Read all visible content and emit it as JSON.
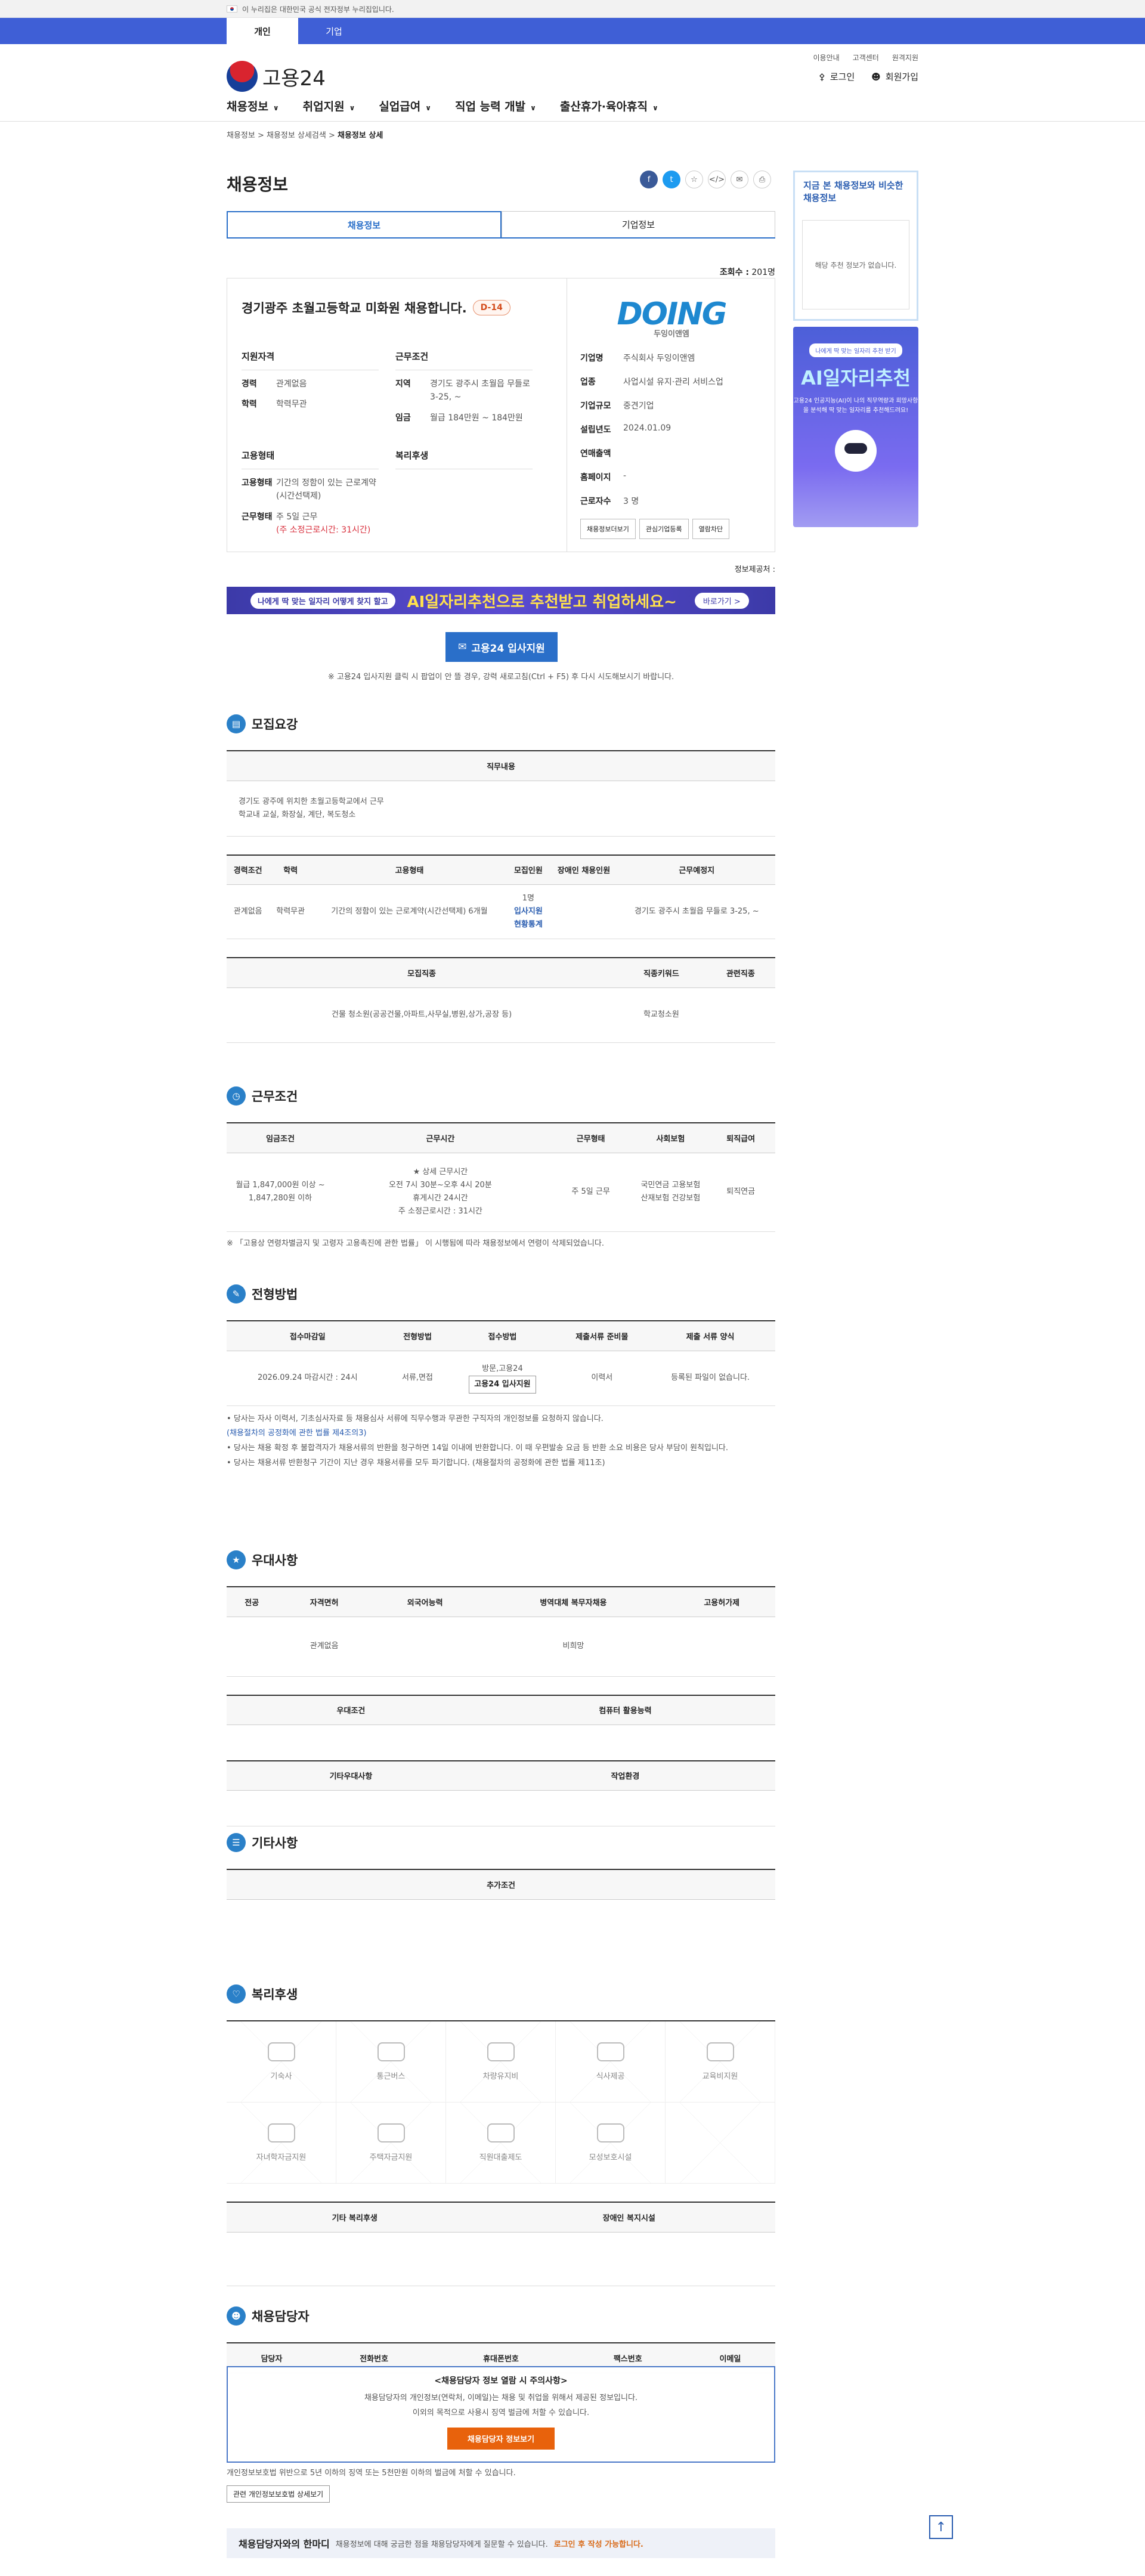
{
  "gov": {
    "text": "이 누리집은 대한민국 공식 전자정부 누리집입니다."
  },
  "user_tabs": [
    "개인",
    "기업"
  ],
  "brand": {
    "name": "고용24"
  },
  "util_links": [
    "이용안내",
    "고객센터",
    "원격지원"
  ],
  "account": {
    "login": "로그인",
    "join": "회원가입"
  },
  "gnb": [
    "채용정보",
    "취업지원",
    "실업급여",
    "직업 능력 개발",
    "출산휴가·육아휴직"
  ],
  "breadcrumb": {
    "a": "채용정보",
    "b": "채용정보 상세검색",
    "c": "채용정보 상세"
  },
  "page": {
    "title": "채용정보",
    "tab1": "채용정보",
    "tab2": "기업정보",
    "views_label": "조회수 :",
    "views": "201명"
  },
  "job": {
    "title": "경기광주 초월고등학교 미화원 채용합니다.",
    "dday": "D-14",
    "g1": "지원자격",
    "career_k": "경력",
    "career_v": "관계없음",
    "edu_k": "학력",
    "edu_v": "학력무관",
    "g2": "근무조건",
    "region_k": "지역",
    "region_v": "경기도 광주시 초월읍 무들로 3-25, ~",
    "wage_k": "임금",
    "wage_v": "월급 184만원 ~ 184만원",
    "g3": "고용형태",
    "type_k": "고용형태",
    "type_v": "기간의 정함이 있는 근로계약(시간선택제)",
    "hours_k": "근무형태",
    "hours_v": "주 5일 근무",
    "hours_v2": "(주 소정근로시간: 31시간)",
    "g4": "복리후생"
  },
  "company": {
    "logo": "DOING",
    "logo_sub": "두잉이앤엠",
    "rows": [
      {
        "k": "기업명",
        "v": "주식회사 두잉이앤엠"
      },
      {
        "k": "업종",
        "v": "사업시설 유지·관리 서비스업"
      },
      {
        "k": "기업규모",
        "v": "중견기업"
      },
      {
        "k": "설립년도",
        "v": "2024.01.09"
      },
      {
        "k": "연매출액",
        "v": ""
      },
      {
        "k": "홈페이지",
        "v": "-"
      },
      {
        "k": "근로자수",
        "v": "3 명"
      }
    ],
    "btn1": "채용정보더보기",
    "btn2": "관심기업등록",
    "btn3": "열람차단"
  },
  "provider": "정보제공처 : ",
  "ad": {
    "pill": "나에게 딱 맞는 일자리 어떻게 찾지 할고",
    "big": "AI일자리추천으로 추천받고 취업하세요~",
    "btn": "바로가기 >"
  },
  "apply": {
    "label": "고용24 입사지원",
    "note": "※ 고용24 입사지원 클릭 시 팝업이 안 뜰 경우, 강력 새로고침(Ctrl + F5) 후 다시 시도해보시기 바랍니다."
  },
  "s1": {
    "title": "모집요강",
    "duty_h": "직무내용",
    "duty_l1": "경기도 광주에 위치한 초월고등학교에서 근무",
    "duty_l2": "학교내 교실, 화장실, 계단, 복도청소",
    "cols": [
      "경력조건",
      "학력",
      "고용형태",
      "모집인원",
      "장애인 채용인원",
      "근무예정지"
    ],
    "row": [
      "관계없음",
      "학력무관",
      "기간의 정함이 있는 근로계약(시간선택제) 6개월",
      "1명",
      "",
      "경기도 광주시 초월읍 무들로 3-25, ~"
    ],
    "apply_status": "입사지원",
    "current": "현황통계",
    "cols2": [
      "모집직종",
      "직종키워드",
      "관련직종"
    ],
    "row2": [
      "건물 청소원(공공건물,아파트,사무실,병원,상가,공장 등)",
      "학교청소원",
      ""
    ]
  },
  "s2": {
    "title": "근무조건",
    "cols": [
      "임금조건",
      "근무시간",
      "근무형태",
      "사회보험",
      "퇴직급여"
    ],
    "wage": "월급 1,847,000원 이상 ~ 1,847,280원 이하",
    "time1": "★ 상세 근무시간",
    "time2": "오전 7시 30분~오후 4시 20분",
    "time3": "휴게시간 24시간",
    "time4": "주 소정근로시간 : 31시간",
    "form": "주 5일 근무",
    "ins": "국민연금 고용보험 산재보험 건강보험",
    "ret": "퇴직연금",
    "note": "※ 「고용상 연령차별금지 및 고령자 고용촉진에 관한 법률」 이 시행됨에 따라 채용정보에서 연령이 삭제되었습니다."
  },
  "s3": {
    "title": "전형방법",
    "cols": [
      "접수마감일",
      "전형방법",
      "접수방법",
      "제출서류 준비물",
      "제출 서류 양식"
    ],
    "row": [
      "2026.09.24 마감시간 : 24시",
      "서류,면접",
      "방문,고용24",
      "이력서",
      "등록된 파일이 없습니다."
    ],
    "btn": "고용24 입사지원",
    "n1": "당사는 자사 이력서, 기초심사자료 등 채용심사 서류에 직무수행과 무관한 구직자의 개인정보를 요청하지 않습니다.",
    "n2": "(채용절차의 공정화에 관한 법률 제4조의3)",
    "n3": "당사는 채용 확정 후 불합격자가 채용서류의 반환을 청구하면 14일 이내에 반환합니다. 이 때 우편발송 요금 등 반환 소요 비용은 당사 부담이 원칙입니다.",
    "n4": "당사는 채용서류 반환청구 기간이 지난 경우 채용서류를 모두 파기합니다. (채용절차의 공정화에 관한 법률 제11조)"
  },
  "s4": {
    "title": "우대사항",
    "cols": [
      "전공",
      "자격면허",
      "외국어능력",
      "병역대체 복무자채용",
      "고용허가제"
    ],
    "row": [
      "",
      "관계없음",
      "",
      "비희망",
      ""
    ],
    "c1": "우대조건",
    "c2": "컴퓨터 활용능력",
    "c3": "기타우대사항",
    "c4": "작업환경"
  },
  "s5": {
    "title": "기타사항",
    "h": "추가조건"
  },
  "s6": {
    "title": "복리후생",
    "items": [
      "기숙사",
      "통근버스",
      "차량유지비",
      "식사제공",
      "교육비지원",
      "자녀학자금지원",
      "주택자금지원",
      "직원대출제도",
      "모성보호시설",
      ""
    ],
    "c1": "기타 복리후생",
    "c2": "장애인 복지시설"
  },
  "s7": {
    "title": "채용담당자",
    "cols": [
      "담당자",
      "전화번호",
      "휴대폰번호",
      "팩스번호",
      "이메일"
    ],
    "ov_title": "<채용담당자 정보 열람 시 주의사항>",
    "ov_p1": "채용담당자의 개인정보(연락처, 이메일)는 채용 및 취업을 위해서 제공된 정보입니다.",
    "ov_p2": "이외의 목적으로 사용시 징역 벌금에 처할 수 있습니다.",
    "ov_btn": "채용담당자 정보보기",
    "law": "개인정보보호법 위반으로 5년 이하의 징역 또는 5천만원 이하의 벌금에 처할 수 있습니다.",
    "law_btn": "관련 개인정보보호법 상세보기"
  },
  "footnote": {
    "title": "채용담당자와의 한마디",
    "text": "채용정보에 대해 궁금한 점을 채용담당자에게 질문할 수 있습니다.",
    "o": "로그인 후 작성 가능합니다."
  },
  "side": {
    "title": "지금 본 채용정보와 비슷한 채용정보",
    "empty": "해당 추천 정보가 없습니다.",
    "ad_pill": "나에게 딱 맞는 일자리 추천 받기",
    "ad_title": "AI일자리추천",
    "ad_text": "고용24 인공지능(AI)이 나의 직무역량과 희망사항을 분석해 딱 맞는 일자리를 추천해드려요!"
  }
}
